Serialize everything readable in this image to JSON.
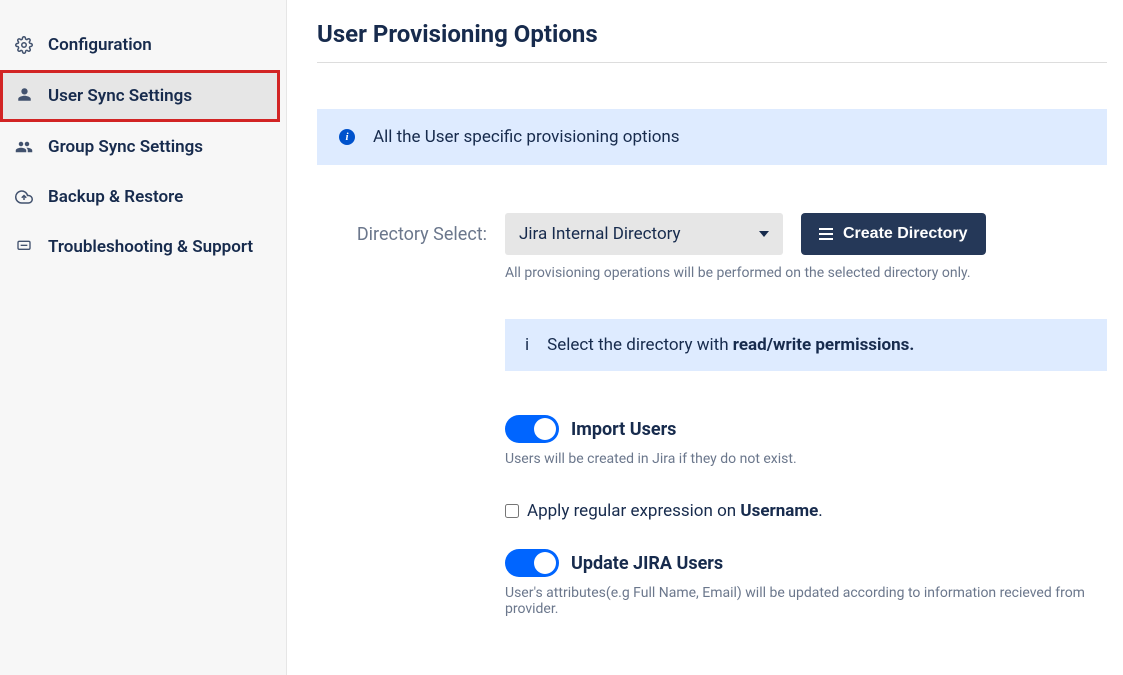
{
  "sidebar": {
    "items": [
      {
        "label": "Configuration",
        "icon": "gear"
      },
      {
        "label": "User Sync Settings",
        "icon": "user"
      },
      {
        "label": "Group Sync Settings",
        "icon": "users"
      },
      {
        "label": "Backup & Restore",
        "icon": "cloud"
      },
      {
        "label": "Troubleshooting & Support",
        "icon": "chat"
      }
    ]
  },
  "page": {
    "title": "User Provisioning Options"
  },
  "banner": {
    "text": "All the User specific provisioning options"
  },
  "directory": {
    "label": "Directory Select:",
    "selected": "Jira Internal Directory",
    "create_button": "Create Directory",
    "helper": "All provisioning operations will be performed on the selected directory only.",
    "permission_hint_prefix": "Select the directory with ",
    "permission_hint_strong": "read/write permissions."
  },
  "import": {
    "label": "Import Users",
    "enabled": true,
    "helper": "Users will be created in Jira if they do not exist."
  },
  "regex": {
    "prefix": "Apply regular expression on ",
    "strong": "Username",
    "suffix": ".",
    "checked": false
  },
  "update": {
    "label": "Update JIRA Users",
    "enabled": true,
    "helper": "User's attributes(e.g Full Name, Email) will be updated according to information recieved from provider."
  }
}
